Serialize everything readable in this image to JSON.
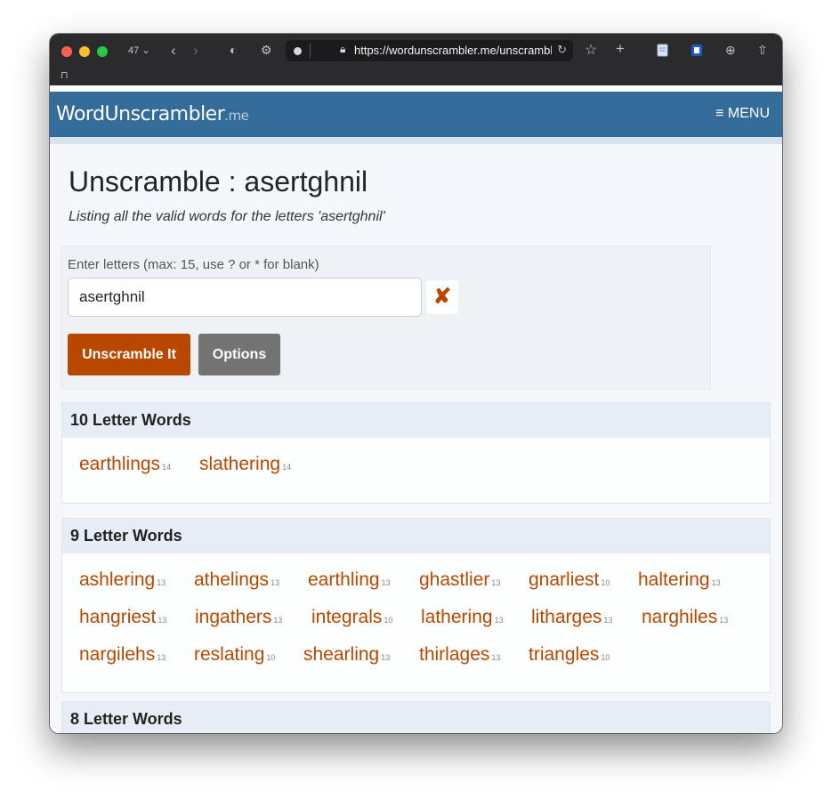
{
  "browser": {
    "tab_count": "47",
    "url": "https://wordunscrambler.me/unscramble/asertghnil"
  },
  "site": {
    "brand_main": "WordUnscrambler",
    "brand_suffix": ".me",
    "menu_label": "≡ MENU"
  },
  "page": {
    "title": "Unscramble : asertghnil",
    "subtitle": "Listing all the valid words for the letters 'asertghnil'"
  },
  "form": {
    "label": "Enter letters (max: 15, use ? or * for blank)",
    "value": "asertghnil",
    "clear_glyph": "✘",
    "unscramble_label": "Unscramble It",
    "options_label": "Options"
  },
  "sections": [
    {
      "heading": "10 Letter Words",
      "words": [
        {
          "word": "earthlings",
          "score": "14"
        },
        {
          "word": "slathering",
          "score": "14"
        }
      ]
    },
    {
      "heading": "9 Letter Words",
      "words": [
        {
          "word": "ashlering",
          "score": "13"
        },
        {
          "word": "athelings",
          "score": "13"
        },
        {
          "word": "earthling",
          "score": "13"
        },
        {
          "word": "ghastlier",
          "score": "13"
        },
        {
          "word": "gnarliest",
          "score": "10"
        },
        {
          "word": "haltering",
          "score": "13"
        },
        {
          "word": "hangriest",
          "score": "13"
        },
        {
          "word": "ingathers",
          "score": "13"
        },
        {
          "word": "integrals",
          "score": "10"
        },
        {
          "word": "lathering",
          "score": "13"
        },
        {
          "word": "litharges",
          "score": "13"
        },
        {
          "word": "narghiles",
          "score": "13"
        },
        {
          "word": "nargilehs",
          "score": "13"
        },
        {
          "word": "reslating",
          "score": "10"
        },
        {
          "word": "shearling",
          "score": "13"
        },
        {
          "word": "thirlages",
          "score": "13"
        },
        {
          "word": "triangles",
          "score": "10"
        }
      ]
    },
    {
      "heading": "8 Letter Words",
      "words": []
    }
  ]
}
